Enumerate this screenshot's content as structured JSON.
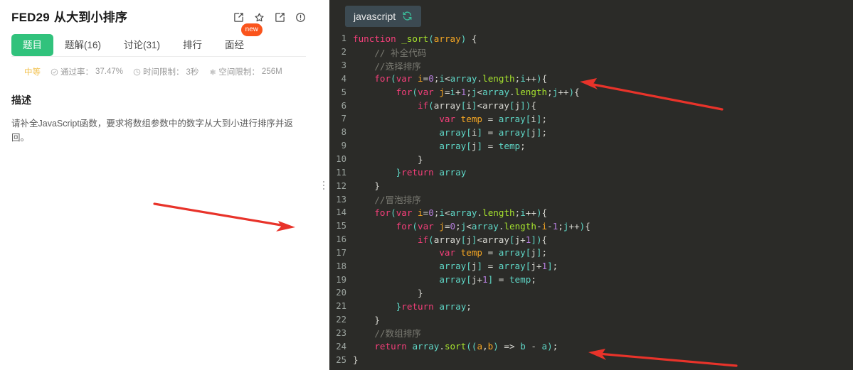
{
  "problem": {
    "code": "FED29",
    "name": "从大到小排序",
    "header_icons": [
      {
        "name": "edit-icon",
        "glyph": "edit-square"
      },
      {
        "name": "star-icon",
        "glyph": "star-outline"
      },
      {
        "name": "share-icon",
        "glyph": "external-link"
      },
      {
        "name": "info-icon",
        "glyph": "exclamation-circle"
      }
    ],
    "tabs": [
      {
        "label": "题目",
        "active": true,
        "badge": null
      },
      {
        "label": "题解(16)",
        "active": false,
        "badge": null
      },
      {
        "label": "讨论(31)",
        "active": false,
        "badge": null
      },
      {
        "label": "排行",
        "active": false,
        "badge": null
      },
      {
        "label": "面经",
        "active": false,
        "badge": "new"
      }
    ],
    "meta": {
      "difficulty": "中等",
      "pass_rate_label": "通过率：",
      "pass_rate_value": "37.47%",
      "time_limit_label": "时间限制：",
      "time_limit_value": "3秒",
      "space_limit_label": "空间限制：",
      "space_limit_value": "256M"
    },
    "description_title": "描述",
    "description_text": "请补全JavaScript函数，要求将数组参数中的数字从大到小进行排序并返回。"
  },
  "editor": {
    "language": "javascript",
    "reset_icon": "refresh-icon",
    "background": "#2b2b28",
    "lines": [
      {
        "n": 1,
        "tokens": [
          {
            "t": "kw",
            "s": "function"
          },
          {
            "t": "pl",
            "s": " "
          },
          {
            "t": "fn",
            "s": "_sort"
          },
          {
            "t": "id",
            "s": "("
          },
          {
            "t": "var",
            "s": "array"
          },
          {
            "t": "id",
            "s": ")"
          },
          {
            "t": "pl",
            "s": " {"
          }
        ]
      },
      {
        "n": 2,
        "tokens": [
          {
            "t": "cm",
            "s": "    // 补全代码"
          }
        ]
      },
      {
        "n": 3,
        "tokens": [
          {
            "t": "cm",
            "s": "    //选择排序"
          }
        ]
      },
      {
        "n": 4,
        "tokens": [
          {
            "t": "pl",
            "s": "    "
          },
          {
            "t": "kw",
            "s": "for"
          },
          {
            "t": "id",
            "s": "("
          },
          {
            "t": "kw",
            "s": "var"
          },
          {
            "t": "pl",
            "s": " "
          },
          {
            "t": "var",
            "s": "i"
          },
          {
            "t": "pl",
            "s": "="
          },
          {
            "t": "num",
            "s": "0"
          },
          {
            "t": "pl",
            "s": ";"
          },
          {
            "t": "id",
            "s": "i"
          },
          {
            "t": "pl",
            "s": "<"
          },
          {
            "t": "id",
            "s": "array"
          },
          {
            "t": "pl",
            "s": "."
          },
          {
            "t": "fn",
            "s": "length"
          },
          {
            "t": "pl",
            "s": ";"
          },
          {
            "t": "id",
            "s": "i"
          },
          {
            "t": "pl",
            "s": "++"
          },
          {
            "t": "id",
            "s": ")"
          },
          {
            "t": "pl",
            "s": "{"
          }
        ]
      },
      {
        "n": 5,
        "tokens": [
          {
            "t": "pl",
            "s": "        "
          },
          {
            "t": "kw",
            "s": "for"
          },
          {
            "t": "id",
            "s": "("
          },
          {
            "t": "kw",
            "s": "var"
          },
          {
            "t": "pl",
            "s": " "
          },
          {
            "t": "var",
            "s": "j"
          },
          {
            "t": "pl",
            "s": "="
          },
          {
            "t": "id",
            "s": "i"
          },
          {
            "t": "pl",
            "s": "+"
          },
          {
            "t": "num",
            "s": "1"
          },
          {
            "t": "pl",
            "s": ";"
          },
          {
            "t": "id",
            "s": "j"
          },
          {
            "t": "pl",
            "s": "<"
          },
          {
            "t": "id",
            "s": "array"
          },
          {
            "t": "pl",
            "s": "."
          },
          {
            "t": "fn",
            "s": "length"
          },
          {
            "t": "pl",
            "s": ";"
          },
          {
            "t": "id",
            "s": "j"
          },
          {
            "t": "pl",
            "s": "++"
          },
          {
            "t": "id",
            "s": ")"
          },
          {
            "t": "pl",
            "s": "{"
          }
        ]
      },
      {
        "n": 6,
        "tokens": [
          {
            "t": "pl",
            "s": "            "
          },
          {
            "t": "kw",
            "s": "if"
          },
          {
            "t": "id",
            "s": "("
          },
          {
            "t": "pl",
            "s": "array"
          },
          {
            "t": "id",
            "s": "["
          },
          {
            "t": "pl",
            "s": "i"
          },
          {
            "t": "id",
            "s": "]"
          },
          {
            "t": "pl",
            "s": "<array"
          },
          {
            "t": "id",
            "s": "["
          },
          {
            "t": "pl",
            "s": "j"
          },
          {
            "t": "id",
            "s": "]"
          },
          {
            "t": "id",
            "s": ")"
          },
          {
            "t": "pl",
            "s": "{"
          }
        ]
      },
      {
        "n": 7,
        "tokens": [
          {
            "t": "pl",
            "s": "                "
          },
          {
            "t": "kw",
            "s": "var"
          },
          {
            "t": "pl",
            "s": " "
          },
          {
            "t": "var",
            "s": "temp"
          },
          {
            "t": "pl",
            "s": " = "
          },
          {
            "t": "id",
            "s": "array"
          },
          {
            "t": "id",
            "s": "["
          },
          {
            "t": "pl",
            "s": "i"
          },
          {
            "t": "id",
            "s": "]"
          },
          {
            "t": "pl",
            "s": ";"
          }
        ]
      },
      {
        "n": 8,
        "tokens": [
          {
            "t": "pl",
            "s": "                "
          },
          {
            "t": "id",
            "s": "array"
          },
          {
            "t": "id",
            "s": "["
          },
          {
            "t": "pl",
            "s": "i"
          },
          {
            "t": "id",
            "s": "]"
          },
          {
            "t": "pl",
            "s": " = "
          },
          {
            "t": "id",
            "s": "array"
          },
          {
            "t": "id",
            "s": "["
          },
          {
            "t": "pl",
            "s": "j"
          },
          {
            "t": "id",
            "s": "]"
          },
          {
            "t": "pl",
            "s": ";"
          }
        ]
      },
      {
        "n": 9,
        "tokens": [
          {
            "t": "pl",
            "s": "                "
          },
          {
            "t": "id",
            "s": "array"
          },
          {
            "t": "id",
            "s": "["
          },
          {
            "t": "pl",
            "s": "j"
          },
          {
            "t": "id",
            "s": "]"
          },
          {
            "t": "pl",
            "s": " = "
          },
          {
            "t": "id",
            "s": "temp"
          },
          {
            "t": "pl",
            "s": ";"
          }
        ]
      },
      {
        "n": 10,
        "tokens": [
          {
            "t": "pl",
            "s": "            }"
          }
        ]
      },
      {
        "n": 11,
        "tokens": [
          {
            "t": "pl",
            "s": "        "
          },
          {
            "t": "id",
            "s": "}"
          },
          {
            "t": "kw",
            "s": "return"
          },
          {
            "t": "pl",
            "s": " "
          },
          {
            "t": "id",
            "s": "array"
          }
        ]
      },
      {
        "n": 12,
        "tokens": [
          {
            "t": "pl",
            "s": "    }"
          }
        ]
      },
      {
        "n": 13,
        "tokens": [
          {
            "t": "cm",
            "s": "    //冒泡排序"
          }
        ]
      },
      {
        "n": 14,
        "tokens": [
          {
            "t": "pl",
            "s": "    "
          },
          {
            "t": "kw",
            "s": "for"
          },
          {
            "t": "id",
            "s": "("
          },
          {
            "t": "kw",
            "s": "var"
          },
          {
            "t": "pl",
            "s": " "
          },
          {
            "t": "var",
            "s": "i"
          },
          {
            "t": "pl",
            "s": "="
          },
          {
            "t": "num",
            "s": "0"
          },
          {
            "t": "pl",
            "s": ";"
          },
          {
            "t": "id",
            "s": "i"
          },
          {
            "t": "pl",
            "s": "<"
          },
          {
            "t": "id",
            "s": "array"
          },
          {
            "t": "pl",
            "s": "."
          },
          {
            "t": "fn",
            "s": "length"
          },
          {
            "t": "pl",
            "s": ";"
          },
          {
            "t": "id",
            "s": "i"
          },
          {
            "t": "pl",
            "s": "++"
          },
          {
            "t": "id",
            "s": ")"
          },
          {
            "t": "pl",
            "s": "{"
          }
        ]
      },
      {
        "n": 15,
        "tokens": [
          {
            "t": "pl",
            "s": "        "
          },
          {
            "t": "kw",
            "s": "for"
          },
          {
            "t": "id",
            "s": "("
          },
          {
            "t": "kw",
            "s": "var"
          },
          {
            "t": "pl",
            "s": " "
          },
          {
            "t": "var",
            "s": "j"
          },
          {
            "t": "pl",
            "s": "="
          },
          {
            "t": "num",
            "s": "0"
          },
          {
            "t": "pl",
            "s": ";"
          },
          {
            "t": "id",
            "s": "j"
          },
          {
            "t": "pl",
            "s": "<"
          },
          {
            "t": "id",
            "s": "array"
          },
          {
            "t": "pl",
            "s": "."
          },
          {
            "t": "fn",
            "s": "length"
          },
          {
            "t": "pl",
            "s": "-"
          },
          {
            "t": "var",
            "s": "i"
          },
          {
            "t": "pl",
            "s": "-"
          },
          {
            "t": "num",
            "s": "1"
          },
          {
            "t": "pl",
            "s": ";"
          },
          {
            "t": "id",
            "s": "j"
          },
          {
            "t": "pl",
            "s": "++"
          },
          {
            "t": "id",
            "s": ")"
          },
          {
            "t": "pl",
            "s": "{"
          }
        ]
      },
      {
        "n": 16,
        "tokens": [
          {
            "t": "pl",
            "s": "            "
          },
          {
            "t": "kw",
            "s": "if"
          },
          {
            "t": "id",
            "s": "("
          },
          {
            "t": "pl",
            "s": "array"
          },
          {
            "t": "id",
            "s": "["
          },
          {
            "t": "pl",
            "s": "j"
          },
          {
            "t": "id",
            "s": "]"
          },
          {
            "t": "pl",
            "s": "<array"
          },
          {
            "t": "id",
            "s": "["
          },
          {
            "t": "pl",
            "s": "j"
          },
          {
            "t": "pl",
            "s": "+"
          },
          {
            "t": "num",
            "s": "1"
          },
          {
            "t": "id",
            "s": "]"
          },
          {
            "t": "id",
            "s": ")"
          },
          {
            "t": "pl",
            "s": "{"
          }
        ]
      },
      {
        "n": 17,
        "tokens": [
          {
            "t": "pl",
            "s": "                "
          },
          {
            "t": "kw",
            "s": "var"
          },
          {
            "t": "pl",
            "s": " "
          },
          {
            "t": "var",
            "s": "temp"
          },
          {
            "t": "pl",
            "s": " = "
          },
          {
            "t": "id",
            "s": "array"
          },
          {
            "t": "id",
            "s": "["
          },
          {
            "t": "pl",
            "s": "j"
          },
          {
            "t": "id",
            "s": "]"
          },
          {
            "t": "pl",
            "s": ";"
          }
        ]
      },
      {
        "n": 18,
        "tokens": [
          {
            "t": "pl",
            "s": "                "
          },
          {
            "t": "id",
            "s": "array"
          },
          {
            "t": "id",
            "s": "["
          },
          {
            "t": "pl",
            "s": "j"
          },
          {
            "t": "id",
            "s": "]"
          },
          {
            "t": "pl",
            "s": " = "
          },
          {
            "t": "id",
            "s": "array"
          },
          {
            "t": "id",
            "s": "["
          },
          {
            "t": "pl",
            "s": "j"
          },
          {
            "t": "pl",
            "s": "+"
          },
          {
            "t": "num",
            "s": "1"
          },
          {
            "t": "id",
            "s": "]"
          },
          {
            "t": "pl",
            "s": ";"
          }
        ]
      },
      {
        "n": 19,
        "tokens": [
          {
            "t": "pl",
            "s": "                "
          },
          {
            "t": "id",
            "s": "array"
          },
          {
            "t": "id",
            "s": "["
          },
          {
            "t": "pl",
            "s": "j"
          },
          {
            "t": "pl",
            "s": "+"
          },
          {
            "t": "num",
            "s": "1"
          },
          {
            "t": "id",
            "s": "]"
          },
          {
            "t": "pl",
            "s": " = "
          },
          {
            "t": "id",
            "s": "temp"
          },
          {
            "t": "pl",
            "s": ";"
          }
        ]
      },
      {
        "n": 20,
        "tokens": [
          {
            "t": "pl",
            "s": "            }"
          }
        ]
      },
      {
        "n": 21,
        "tokens": [
          {
            "t": "pl",
            "s": "        "
          },
          {
            "t": "id",
            "s": "}"
          },
          {
            "t": "kw",
            "s": "return"
          },
          {
            "t": "pl",
            "s": " "
          },
          {
            "t": "id",
            "s": "array"
          },
          {
            "t": "pl",
            "s": ";"
          }
        ]
      },
      {
        "n": 22,
        "tokens": [
          {
            "t": "pl",
            "s": "    }"
          }
        ]
      },
      {
        "n": 23,
        "tokens": [
          {
            "t": "cm",
            "s": "    //数组排序"
          }
        ]
      },
      {
        "n": 24,
        "tokens": [
          {
            "t": "pl",
            "s": "    "
          },
          {
            "t": "kw",
            "s": "return"
          },
          {
            "t": "pl",
            "s": " "
          },
          {
            "t": "id",
            "s": "array"
          },
          {
            "t": "pl",
            "s": "."
          },
          {
            "t": "fn",
            "s": "sort"
          },
          {
            "t": "id",
            "s": "(("
          },
          {
            "t": "var",
            "s": "a"
          },
          {
            "t": "pl",
            "s": ","
          },
          {
            "t": "var",
            "s": "b"
          },
          {
            "t": "id",
            "s": ")"
          },
          {
            "t": "pl",
            "s": " => "
          },
          {
            "t": "id",
            "s": "b"
          },
          {
            "t": "pl",
            "s": " - "
          },
          {
            "t": "id",
            "s": "a"
          },
          {
            "t": "id",
            "s": ")"
          },
          {
            "t": "pl",
            "s": ";"
          }
        ]
      },
      {
        "n": 25,
        "tokens": [
          {
            "t": "pl",
            "s": "}"
          }
        ]
      }
    ]
  },
  "annotations": {
    "arrow_color": "#e8332a",
    "arrows": [
      {
        "name": "arrow-left-panel",
        "direction": "right-down"
      },
      {
        "name": "arrow-code-top",
        "direction": "left-up"
      },
      {
        "name": "arrow-code-bottom",
        "direction": "left-up"
      }
    ]
  }
}
